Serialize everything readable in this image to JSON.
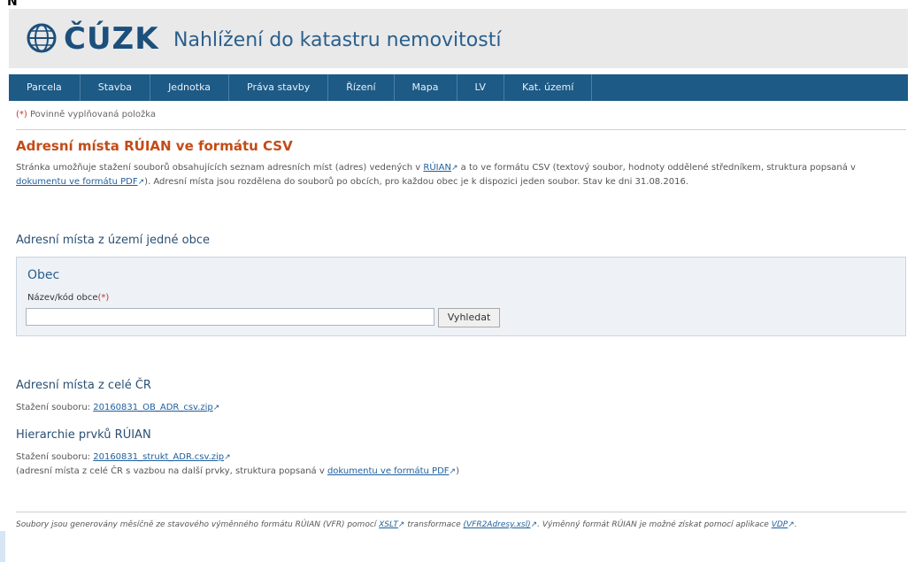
{
  "header": {
    "brand": "ČÚZK",
    "subtitle": "Nahlížení do katastru nemovitostí"
  },
  "nav": {
    "items": [
      {
        "label": "Parcela"
      },
      {
        "label": "Stavba"
      },
      {
        "label": "Jednotka"
      },
      {
        "label": "Práva stavby"
      },
      {
        "label": "Řízení"
      },
      {
        "label": "Mapa"
      },
      {
        "label": "LV"
      },
      {
        "label": "Kat. území"
      }
    ]
  },
  "mandatory_note": {
    "star": "(*)",
    "text": "Povinně vyplňovaná položka"
  },
  "page": {
    "title": "Adresní místa RÚIAN ve formátu CSV",
    "description_1": "Stránka umožňuje stažení souborů obsahujících seznam adresních míst (adres) vedených v ",
    "description_link_ruian": "RÚIAN",
    "description_2": " a to ve formátu CSV (textový soubor, hodnoty oddělené středníkem, struktura popsaná v ",
    "description_link_doc": "dokumentu ve formátu PDF",
    "description_3": "). Adresní místa jsou rozdělena do souborů po obcích, pro každou obec je k dispozici jeden soubor. Stav ke dni 31.08.2016."
  },
  "obec_section": {
    "heading": "Adresní místa z území jedné obce",
    "box_title": "Obec",
    "label": "Název/kód obce",
    "label_star": "(*)",
    "input_value": "",
    "button_label": "Vyhledat"
  },
  "cr_section": {
    "heading": "Adresní místa z celé ČR",
    "download_label": "Stažení souboru: ",
    "download_link": "20160831_OB_ADR_csv.zip"
  },
  "hierarchy_section": {
    "heading": "Hierarchie prvků RÚIAN",
    "download_label": "Stažení souboru: ",
    "download_link": "20160831_strukt_ADR.csv.zip",
    "note_1": "(adresní místa z celé ČR s vazbou na další prvky, struktura popsaná v ",
    "note_link": "dokumentu ve formátu PDF",
    "note_2": ")"
  },
  "footer": {
    "text_1": "Soubory jsou generovány měsíčně ze stavového výměnného formátu RÚIAN (VFR) pomocí ",
    "link_xslt": "XSLT",
    "text_2": " transformace ",
    "link_tool": "(VFR2Adresy.xsl)",
    "text_3": ". Výměnný formát RÚIAN je možné získat pomocí aplikace ",
    "link_vdp": "VDP",
    "text_4": "."
  },
  "colors": {
    "nav_bg": "#1d5a85",
    "title_orange": "#c44b17",
    "link_blue": "#1e5f9e",
    "header_bg": "#e9e9e9"
  }
}
